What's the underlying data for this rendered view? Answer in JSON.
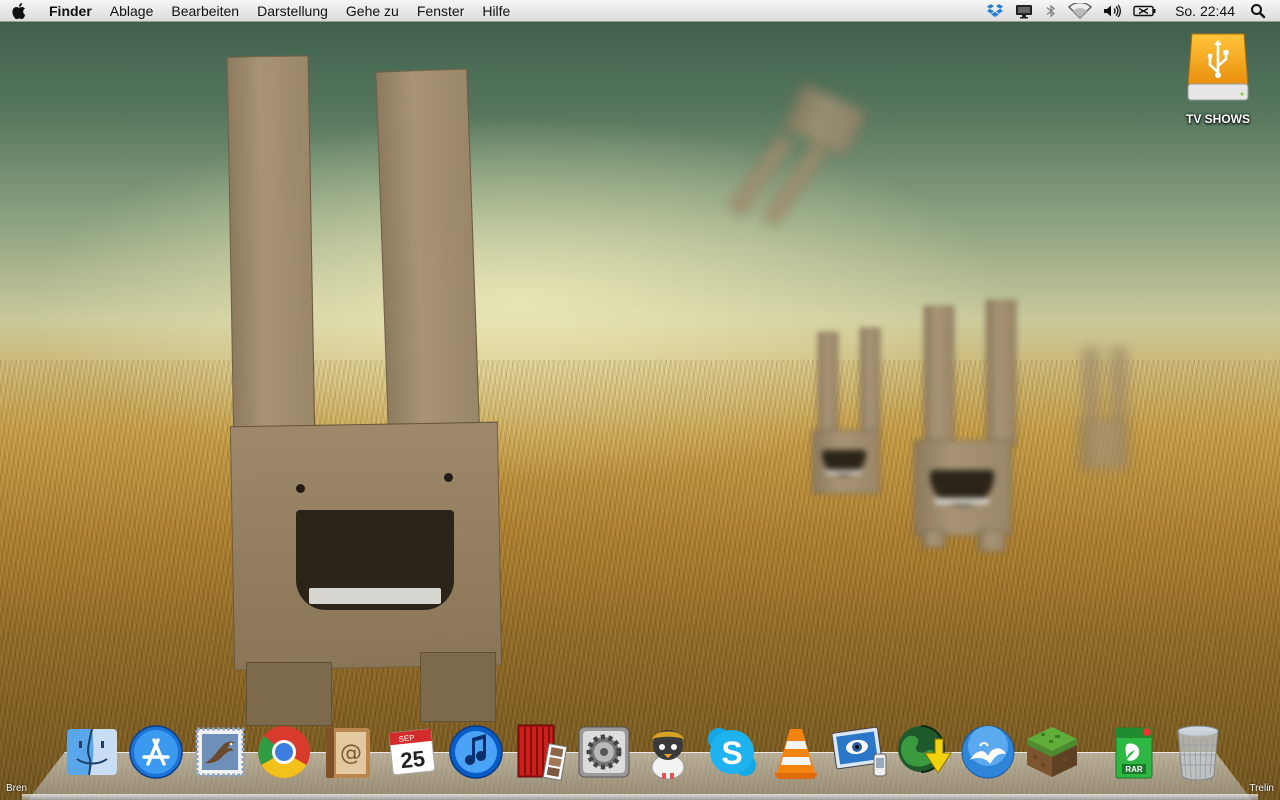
{
  "menubar": {
    "app_name": "Finder",
    "menus": [
      "Ablage",
      "Bearbeiten",
      "Darstellung",
      "Gehe zu",
      "Fenster",
      "Hilfe"
    ],
    "clock": "So. 22:44",
    "status_icons": [
      "dropbox-icon",
      "display-icon",
      "bluetooth-icon",
      "wifi-icon",
      "volume-icon",
      "battery-icon",
      "spotlight-icon"
    ]
  },
  "desktop": {
    "drive_label": "TV SHOWS"
  },
  "dock": {
    "items": [
      "finder-icon",
      "app-store-icon",
      "mail-icon",
      "chrome-icon",
      "address-book-icon",
      "calendar-icon",
      "itunes-icon",
      "photo-booth-icon",
      "system-preferences-icon",
      "adium-icon",
      "skype-icon",
      "vlc-icon",
      "preview-icon",
      "jdownloader-icon",
      "openoffice-icon",
      "minecraft-icon",
      "unrar-icon",
      "trash-icon"
    ],
    "calendar_month": "SEP",
    "calendar_day": "25",
    "rar_label": "RAR",
    "left_edge_label": "Bren",
    "right_edge_label": "Trelin"
  },
  "colors": {
    "menubar_bg": "#e8e8e8",
    "drive_orange": "#f4a316"
  }
}
